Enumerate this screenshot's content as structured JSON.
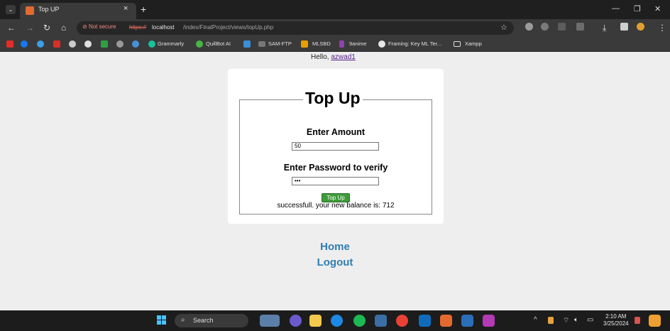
{
  "browser": {
    "tab_title": "Top UP",
    "tab_close": "×",
    "new_tab": "+",
    "tab_menu": "⌄",
    "window_controls": {
      "minimize": "—",
      "restore": "❐",
      "close": "✕"
    },
    "nav": {
      "back": "←",
      "forward": "→",
      "reload": "↻",
      "home": "⌂"
    },
    "security_label": "Not secure",
    "url_scheme": "https://",
    "url_host": "localhost",
    "url_path": "/index/FinalProject/views/topUp.php",
    "star": "☆",
    "toolbar_right": {
      "download": "⤓",
      "menu": "⋮"
    }
  },
  "bookmarks": [
    {
      "label": "Grammarly",
      "icon": "grammarly-icon",
      "color": "#15c39a"
    },
    {
      "label": "QuillBot AI",
      "icon": "quillbot-icon",
      "color": "#4bb543"
    },
    {
      "label": "SAM-FTP",
      "icon": "folder-icon",
      "color": "#888888"
    },
    {
      "label": "MLSBD",
      "icon": "mlsbd-icon",
      "color": "#e8a000"
    },
    {
      "label": "9anime",
      "icon": "9anime-icon",
      "color": "#8e44ad"
    },
    {
      "label": "Framing: Key ML Ter...",
      "icon": "google-icon",
      "color": "#e8e8e8"
    },
    {
      "label": "Xampp",
      "icon": "folder-icon",
      "color": "#e0e0e0"
    }
  ],
  "page": {
    "greeting": "Hello,",
    "username": "azwad1",
    "form_title": "Top Up",
    "amount_label": "Enter Amount",
    "amount_value": "50",
    "password_label": "Enter Password to verify",
    "password_value": "•••",
    "submit_label": "Top Up",
    "result_message": "successfull. your new balance is: 712",
    "links": {
      "home": "Home",
      "logout": "Logout"
    }
  },
  "taskbar": {
    "search_label": "Search",
    "search_icon": "⌕",
    "time": "2:10 AM",
    "date": "3/25/2024",
    "tray": {
      "chevron": "^",
      "wifi": "⌔",
      "volume": "🔈︎",
      "battery": "▭"
    }
  },
  "colors": {
    "accent_link": "#2f7db3",
    "button_green": "#3f9b3a",
    "username_link": "#551a8b"
  }
}
